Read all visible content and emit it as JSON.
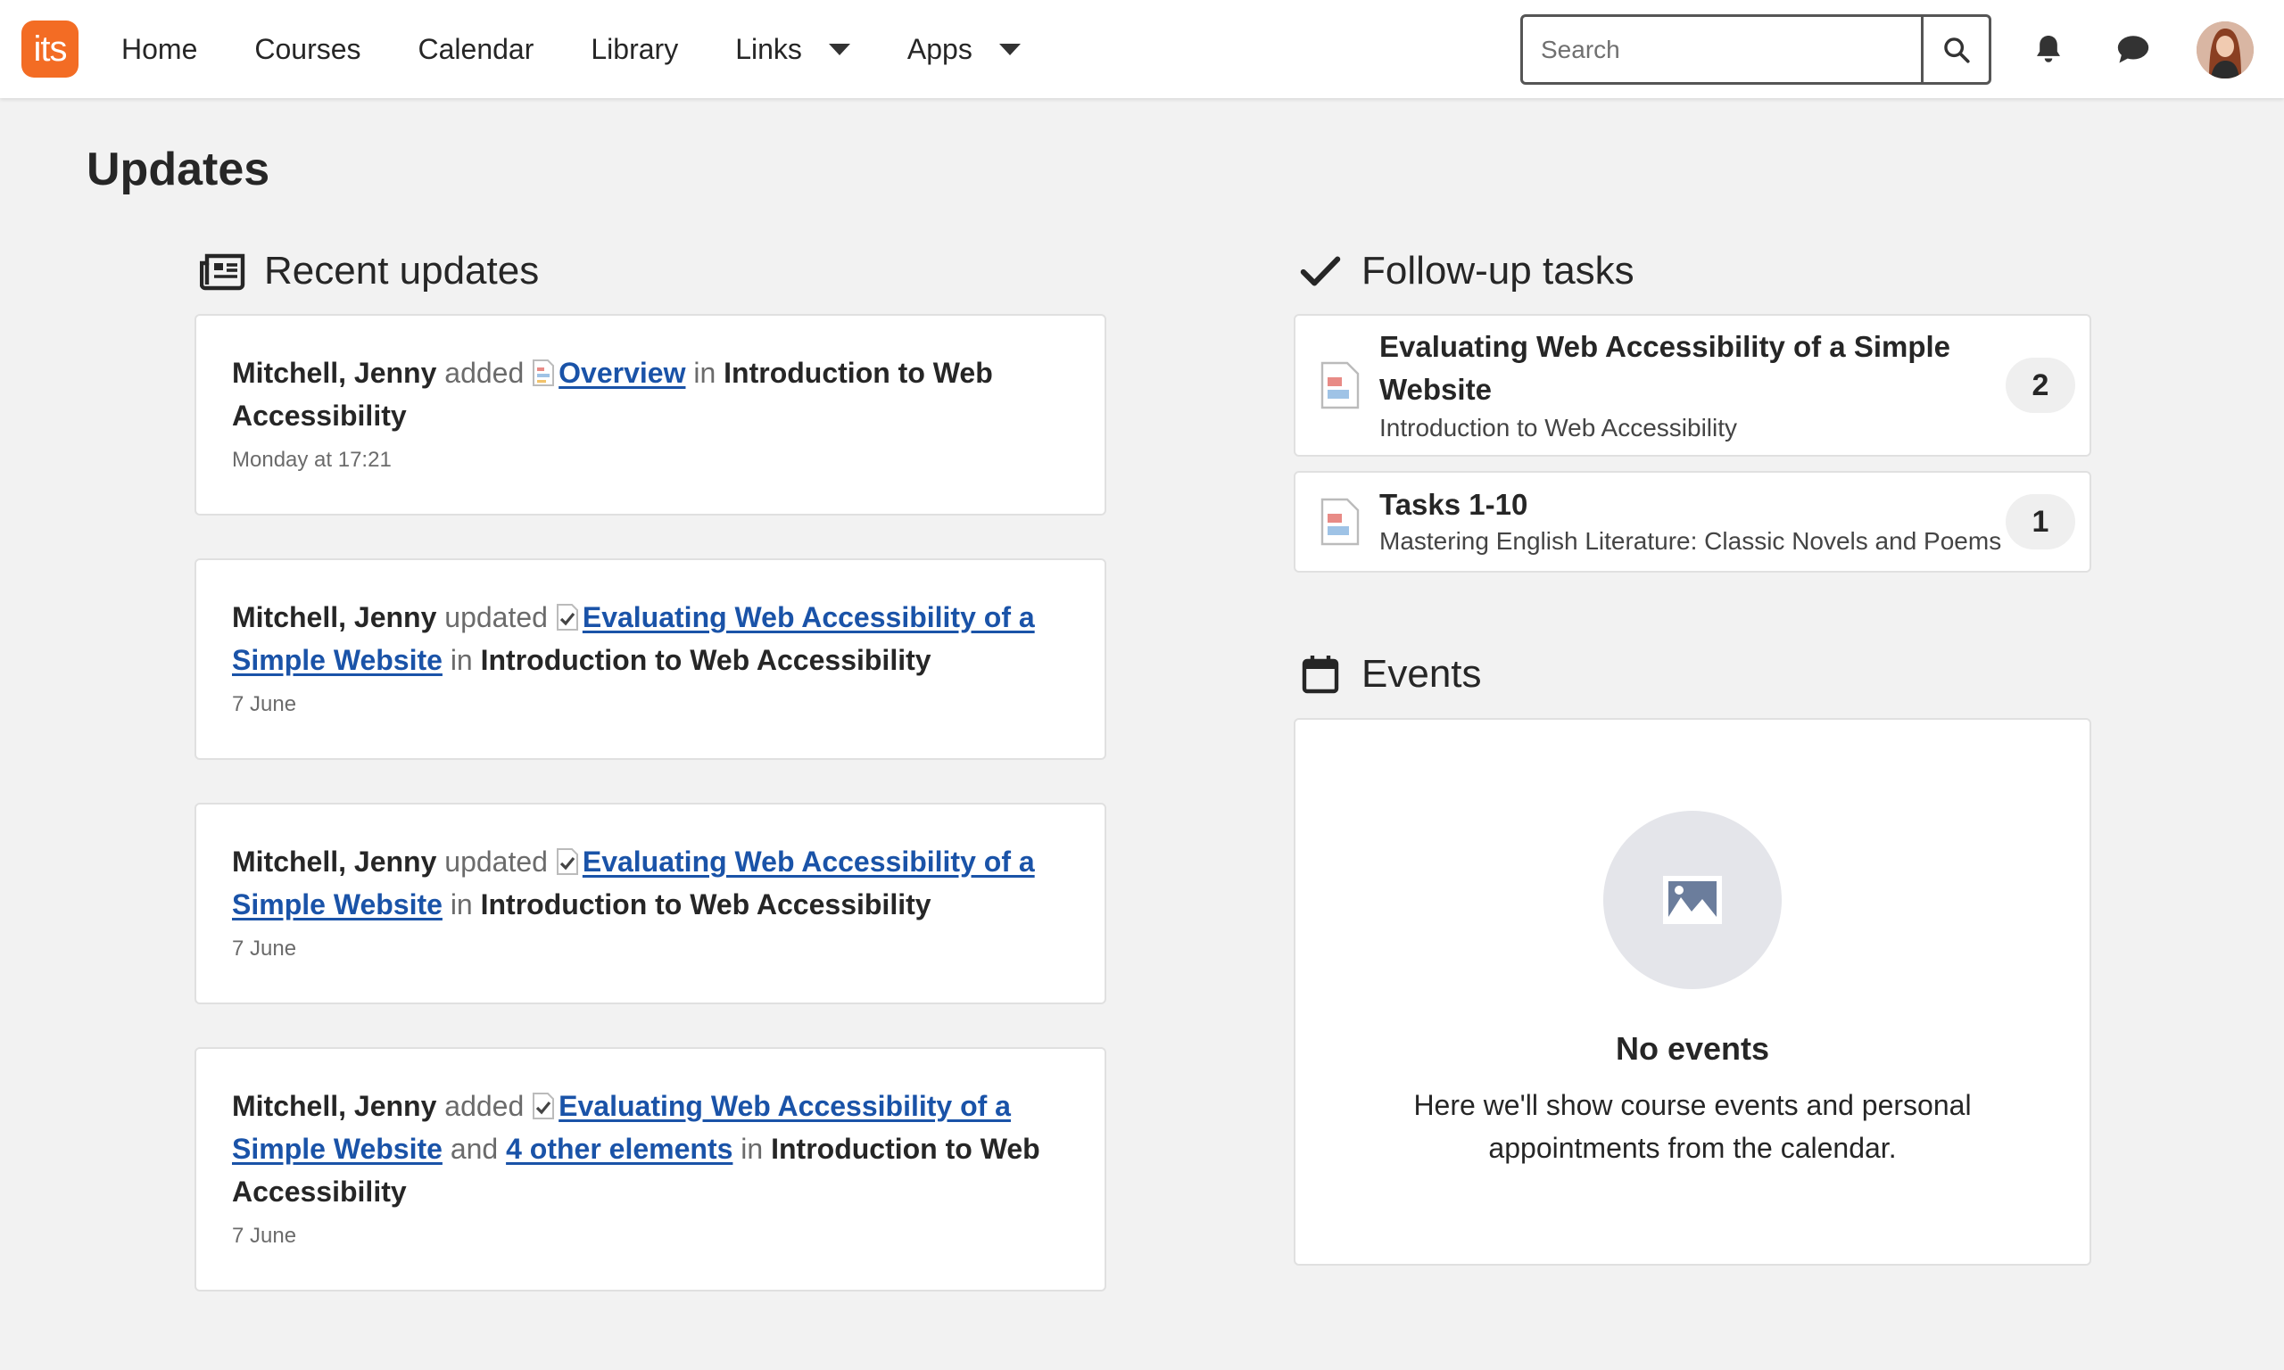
{
  "header": {
    "logo_text": "its",
    "nav": [
      {
        "label": "Home"
      },
      {
        "label": "Courses"
      },
      {
        "label": "Calendar"
      },
      {
        "label": "Library"
      },
      {
        "label": "Links"
      },
      {
        "label": "Apps"
      }
    ],
    "search": {
      "placeholder": "Search",
      "value": ""
    }
  },
  "page": {
    "title": "Updates"
  },
  "recent": {
    "heading": "Recent updates",
    "items": [
      {
        "user": "Mitchell, Jenny",
        "verb": "added",
        "link": "Overview",
        "in": "in",
        "course": "Introduction to Web Accessibility",
        "date": "Monday at 17:21"
      },
      {
        "user": "Mitchell, Jenny",
        "verb": "updated",
        "link": "Evaluating Web Accessibility of a Simple Website",
        "in": "in",
        "course": "Introduction to Web Accessibility",
        "date": "7 June"
      },
      {
        "user": "Mitchell, Jenny",
        "verb": "updated",
        "link": "Evaluating Web Accessibility of a Simple Website",
        "in": "in",
        "course": "Introduction to Web Accessibility",
        "date": "7 June"
      },
      {
        "user": "Mitchell, Jenny",
        "verb": "added",
        "link": "Evaluating Web Accessibility of a Simple Website",
        "and": "and",
        "extra_link": "4 other elements",
        "in": "in",
        "course": "Introduction to Web Accessibility",
        "date": "7 June"
      }
    ]
  },
  "tasks": {
    "heading": "Follow-up tasks",
    "items": [
      {
        "title": "Evaluating Web Accessibility of a Simple Website",
        "course": "Introduction to Web Accessibility",
        "count": "2"
      },
      {
        "title": "Tasks 1-10",
        "course": "Mastering English Literature: Classic Novels and Poems",
        "count": "1"
      }
    ]
  },
  "events": {
    "heading": "Events",
    "empty_title": "No events",
    "empty_text": "Here we'll show course events and personal appointments from the calendar."
  },
  "colors": {
    "brand": "#f36c24",
    "link": "#1a53a8"
  }
}
